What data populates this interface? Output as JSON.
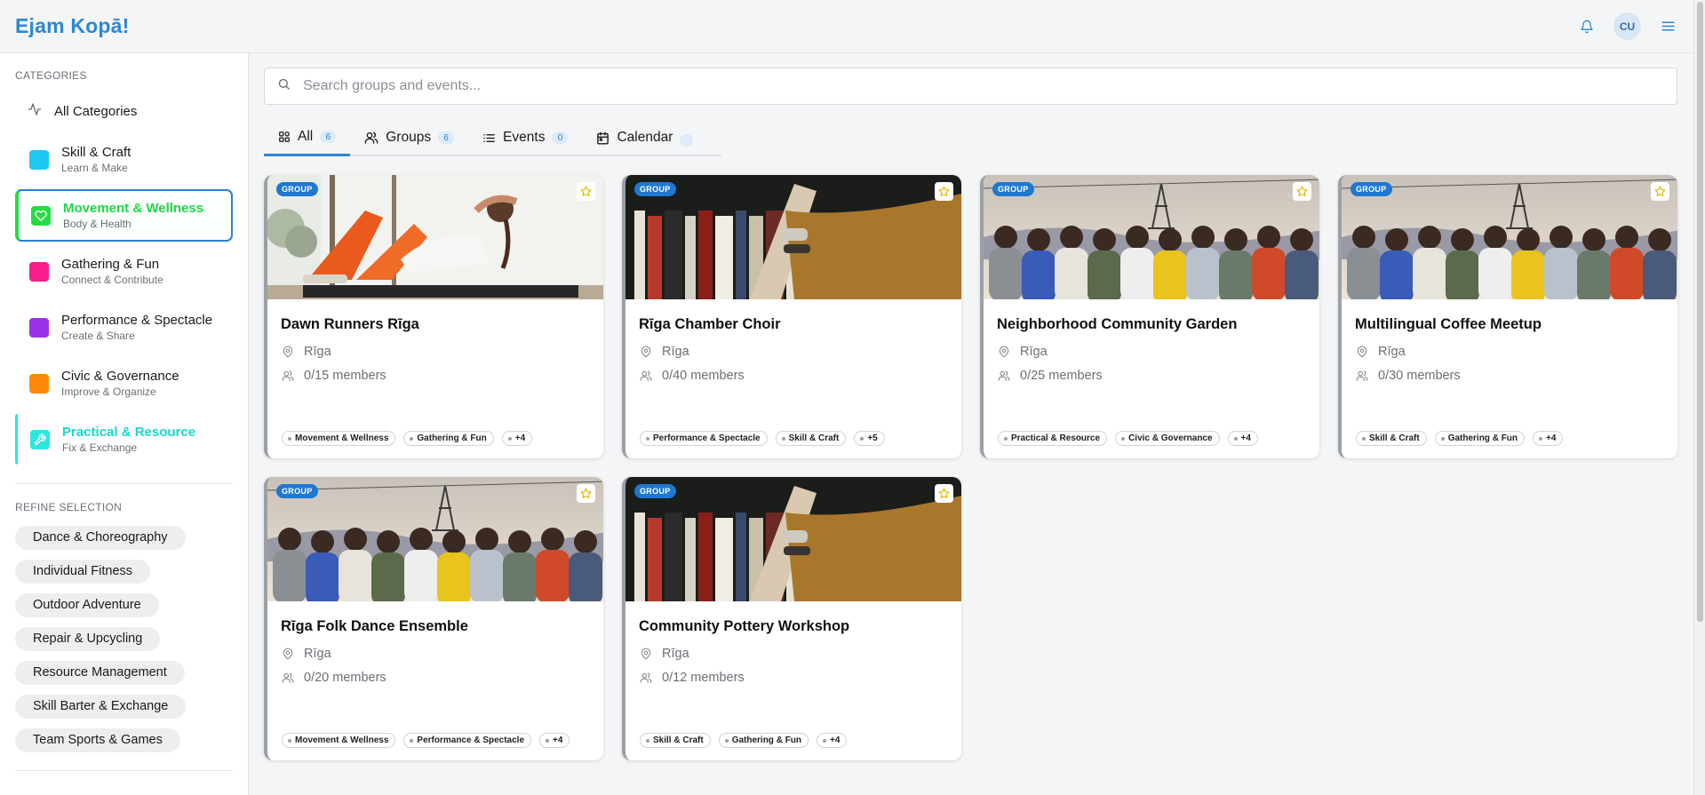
{
  "app": {
    "logo": "Ejam Kopā!"
  },
  "header": {
    "avatar_initials": "CU",
    "icons": [
      "bell-icon",
      "menu-icon"
    ]
  },
  "sidebar": {
    "categories_title": "CATEGORIES",
    "all_label": "All Categories",
    "categories": [
      {
        "name": "Skill & Craft",
        "sub": "Learn & Make",
        "color": "#1ec8f2"
      },
      {
        "name": "Movement & Wellness",
        "sub": "Body & Health",
        "color": "#22dd44",
        "state": "active",
        "icon": "heart-icon"
      },
      {
        "name": "Gathering & Fun",
        "sub": "Connect & Contribute",
        "color": "#f51e8c"
      },
      {
        "name": "Performance & Spectacle",
        "sub": "Create & Share",
        "color": "#9b30e6"
      },
      {
        "name": "Civic & Governance",
        "sub": "Improve & Organize",
        "color": "#ff8a0a"
      },
      {
        "name": "Practical & Resource",
        "sub": "Fix & Exchange",
        "color": "#2ee6e0",
        "state": "selected",
        "icon": "wrench-icon"
      }
    ],
    "refine_title": "REFINE SELECTION",
    "refine_chips": [
      "Dance & Choreography",
      "Individual Fitness",
      "Outdoor Adventure",
      "Repair & Upcycling",
      "Resource Management",
      "Skill Barter & Exchange",
      "Team Sports & Games"
    ]
  },
  "search": {
    "placeholder": "Search groups and events..."
  },
  "tabs": [
    {
      "label": "All",
      "count": "6",
      "icon": "grid-icon"
    },
    {
      "label": "Groups",
      "count": "6",
      "icon": "users-icon"
    },
    {
      "label": "Events",
      "count": "0",
      "icon": "list-icon"
    },
    {
      "label": "Calendar",
      "count": "",
      "icon": "calendar-icon"
    }
  ],
  "cards": [
    {
      "tag": "GROUP",
      "title": "Dawn Runners Rīga",
      "location": "Rīga",
      "members": "0/15 members",
      "image": "fitness",
      "pills": [
        "Movement & Wellness",
        "Gathering & Fun",
        "+4"
      ]
    },
    {
      "tag": "GROUP",
      "title": "Rīga Chamber Choir",
      "location": "Rīga",
      "members": "0/40 members",
      "image": "books",
      "pills": [
        "Performance & Spectacle",
        "Skill & Craft",
        "+5"
      ]
    },
    {
      "tag": "GROUP",
      "title": "Neighborhood Community Garden",
      "location": "Rīga",
      "members": "0/25 members",
      "image": "friends",
      "pills": [
        "Practical & Resource",
        "Civic & Governance",
        "+4"
      ]
    },
    {
      "tag": "GROUP",
      "title": "Multilingual Coffee Meetup",
      "location": "Rīga",
      "members": "0/30 members",
      "image": "friends",
      "pills": [
        "Skill & Craft",
        "Gathering & Fun",
        "+4"
      ]
    },
    {
      "tag": "GROUP",
      "title": "Rīga Folk Dance Ensemble",
      "location": "Rīga",
      "members": "0/20 members",
      "image": "friends",
      "pills": [
        "Movement & Wellness",
        "Performance & Spectacle",
        "+4"
      ]
    },
    {
      "tag": "GROUP",
      "title": "Community Pottery Workshop",
      "location": "Rīga",
      "members": "0/12 members",
      "image": "books",
      "pills": [
        "Skill & Craft",
        "Gathering & Fun",
        "+4"
      ]
    }
  ]
}
